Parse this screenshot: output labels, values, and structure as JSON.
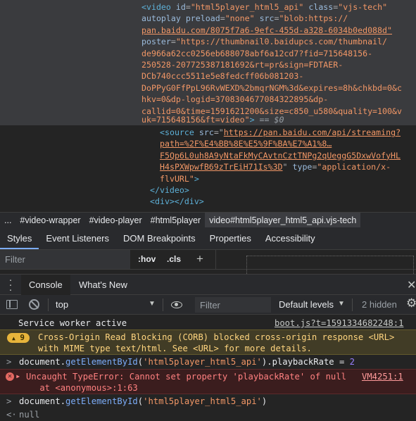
{
  "elements": {
    "video_open_1": "<video id=\"html5player_html5_api\" class=\"vjs-tech\"",
    "video_tag": "video",
    "video_attr_id": "id",
    "video_val_id": "\"html5player_html5_api\"",
    "video_attr_class": "class",
    "video_val_class": "\"vjs-tech\"",
    "video_attr_autoplay": "autoplay",
    "video_attr_preload": "preload",
    "video_val_preload": "\"none\"",
    "video_attr_src": "src",
    "video_val_src_1": "\"blob:https://",
    "video_val_src_2": "pan.baidu.com/8075f7a6-9efc-455d-a328-6034b0ed088d\"",
    "video_attr_poster": "poster",
    "video_val_poster_1": "\"https://thumbnail0.baidupcs.com/thumbnail/",
    "video_val_poster_2": "de966a62cc0256eb688078abf6a12cd7?fid=715648156-",
    "video_val_poster_3": "250528-207725387181692&rt=pr&sign=FDTAER-",
    "video_val_poster_4": "DCb740ccc5511e5e8fedcff06b081203-",
    "video_val_poster_5": "DoPPyG0FfPpL96RvWEXD%2bmqrNGM%3d&expires=8h&chkbd=0&c",
    "video_val_poster_6": "hkv=0&dp-logid=3708304677084322895&dp-",
    "video_val_poster_7": "callid=0&time=1591621200&size=c850_u580&quality=100&v",
    "video_val_poster_8": "uk=715648156&ft=video\"",
    "video_selected_marker": " == $0",
    "source_tag": "source",
    "source_attr_src": "src",
    "source_url_1": "https://pan.baidu.com/api/streaming?",
    "source_url_2": "path=%2F%E4%BB%8E%E5%9F%BA%E7%A1%8…",
    "source_url_3": "F5Qp6L0uh8A9yNtaFkMyCAvtnCztTNPg2qUeggG5DxwVofyHL",
    "source_url_4": "H4sPXWpwfB69zTrEiH71Is%3D",
    "source_attr_type": "type",
    "source_val_type_1": "\"application/x-",
    "source_val_type_2": "flvURL\"",
    "video_close": "</video>",
    "div_line": "<div></div>"
  },
  "breadcrumbs": [
    "...",
    "#video-wrapper",
    "#video-player",
    "#html5player",
    "video#html5player_html5_api.vjs-tech"
  ],
  "styles_tabs": [
    "Styles",
    "Event Listeners",
    "DOM Breakpoints",
    "Properties",
    "Accessibility"
  ],
  "styles_filter": {
    "placeholder": "Filter",
    "hov": ":hov",
    "cls": ".cls",
    "plus": "+"
  },
  "drawer": {
    "console_tab": "Console",
    "whats_new_tab": "What's New",
    "close": "✕"
  },
  "console_toolbar": {
    "context": "top",
    "filter_placeholder": "Filter",
    "levels": "Default levels",
    "hidden": "2 hidden"
  },
  "messages": {
    "sw_text": "Service worker active",
    "sw_link": "boot.js?t=1591334682248:1",
    "warn_count": "9",
    "warn_line1": "Cross-Origin Read Blocking (CORB) blocked cross-origin response <URL>",
    "warn_line2": "with MIME type text/html. See <URL> for more details.",
    "cmd1_pre": "document.",
    "cmd1_fn": "getElementById",
    "cmd1_str": "'html5player_html5_api'",
    "cmd1_prop": ").playbackRate = ",
    "cmd1_num": "2",
    "err_line1": "Uncaught TypeError: Cannot set property 'playbackRate' of null",
    "err_line2": "    at <anonymous>:1:63",
    "err_link": "VM4251:1",
    "cmd2_pre": "document.",
    "cmd2_fn": "getElementById",
    "cmd2_str": "'html5player_html5_api'",
    "cmd2_post": ")",
    "result": "null"
  }
}
